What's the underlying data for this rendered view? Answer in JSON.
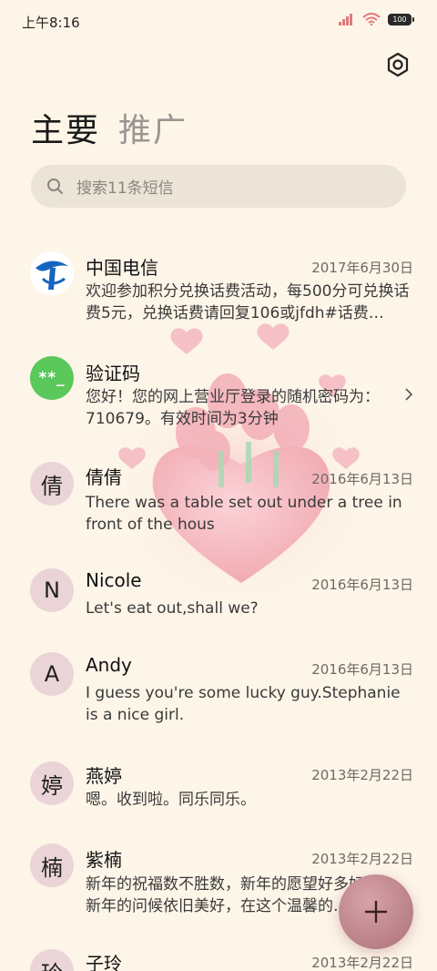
{
  "status": {
    "time": "上午8:16",
    "battery": "100"
  },
  "header": {
    "tab_primary": "主要",
    "tab_promo": "推广"
  },
  "search": {
    "placeholder": "搜索11条短信"
  },
  "conversations": [
    {
      "name": "中国电信",
      "date": "2017年6月30日",
      "preview": "欢迎参加积分兑换话费活动，每500分可兑换话费5元，兑换话费请回复106或jfdh#话费…",
      "avatar": ""
    },
    {
      "name": "验证码",
      "date": "",
      "preview": "您好！您的网上营业厅登录的随机密码为：710679。有效时间为3分钟",
      "avatar": "**_"
    },
    {
      "name": "倩倩",
      "date": "2016年6月13日",
      "preview": "There was a table set out under a tree in front of the hous",
      "avatar": "倩"
    },
    {
      "name": "Nicole",
      "date": "2016年6月13日",
      "preview": "Let's eat out,shall we?",
      "avatar": "N"
    },
    {
      "name": "Andy",
      "date": "2016年6月13日",
      "preview": "I guess you're some lucky guy.Stephanie is a nice girl.",
      "avatar": "A"
    },
    {
      "name": "燕婷",
      "date": "2013年2月22日",
      "preview": "嗯。收到啦。同乐同乐。",
      "avatar": "婷"
    },
    {
      "name": "紫楠",
      "date": "2013年2月22日",
      "preview": "新年的祝福数不胜数，新年的愿望好多好多，新年的问候依旧美好，在这个温馨的…",
      "avatar": "楠"
    },
    {
      "name": "子玲",
      "date": "2013年2月22日",
      "preview": "",
      "avatar": "玲"
    }
  ],
  "icons": {
    "settings": "settings-icon",
    "search": "search-icon",
    "chevron": "chevron-right-icon",
    "compose": "plus-icon"
  },
  "colors": {
    "background": "#fdf5e8",
    "avatar": "#ead4d8",
    "fab": "#b98087",
    "verify_avatar": "#5ac85a",
    "telecom_blue": "#1565c0"
  }
}
